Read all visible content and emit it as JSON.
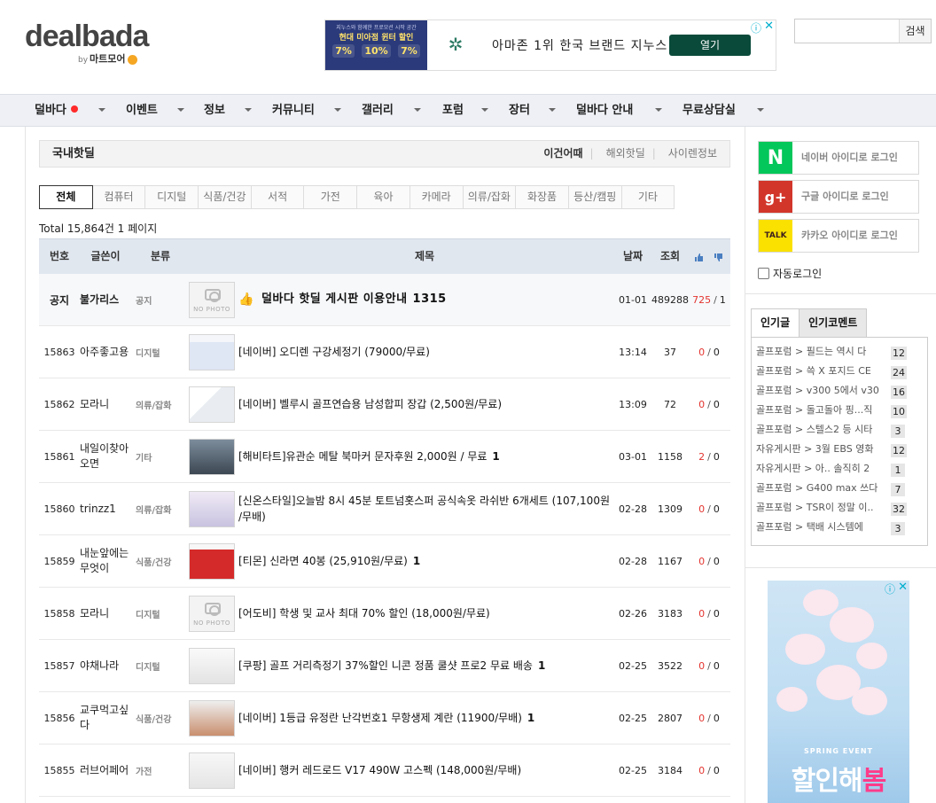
{
  "header": {
    "logo_main_1": "deal",
    "logo_main_2": "bada",
    "logo_by": "by",
    "logo_sub": "마트모어",
    "search_button": "검색",
    "search_placeholder": ""
  },
  "top_ad": {
    "line1": "지누스와 함께한 프로모션 시작 공간",
    "line2": "현대 미아점 윈터 할인",
    "pcts": [
      "7%",
      "10%",
      "7%"
    ],
    "text": "아마존 1위 한국 브랜드 지누스",
    "button": "열기"
  },
  "nav": {
    "items": [
      "덜바다",
      "이벤트",
      "정보",
      "커뮤니티",
      "갤러리",
      "포럼",
      "장터",
      "덜바다 안내",
      "무료상담실"
    ]
  },
  "board": {
    "title": "국내핫딜",
    "tabs": [
      "이건어때",
      "해외핫딜",
      "사이렌정보"
    ],
    "categories": [
      "전체",
      "컴퓨터",
      "디지털",
      "식품/건강",
      "서적",
      "가전",
      "육아",
      "카메라",
      "의류/잡화",
      "화장품",
      "등산/캠핑",
      "기타"
    ],
    "total": "Total 15,864건 1 페이지",
    "columns": {
      "num": "번호",
      "writer": "글쓴이",
      "cat": "분류",
      "title": "제목",
      "date": "날짜",
      "views": "조회"
    },
    "notice": {
      "num": "공지",
      "writer": "불가리스",
      "cat": "공지",
      "title": "덜바다 핫딜 게시판 이용안내",
      "comments": "1315",
      "date": "01-01",
      "views": "489288",
      "up": "725",
      "down": "1"
    },
    "rows": [
      {
        "num": "15863",
        "writer": "아주좋고용",
        "cat": "디지털",
        "title": "[네이버] 오디렌 구강세정기 (79000/무료)",
        "comments": "",
        "date": "13:14",
        "views": "37",
        "up": "0",
        "down": "0"
      },
      {
        "num": "15862",
        "writer": "모라니",
        "cat": "의류/잡화",
        "title": "[네이버] 벨루시 골프연습용 남성합피 장갑 (2,500원/무료)",
        "comments": "",
        "date": "13:09",
        "views": "72",
        "up": "0",
        "down": "0"
      },
      {
        "num": "15861",
        "writer": "내일이찾아오면",
        "cat": "기타",
        "title": "[해비타트]유관순 메탈 북마커 문자후원 2,000원 / 무료",
        "comments": "1",
        "date": "03-01",
        "views": "1158",
        "up": "2",
        "down": "0"
      },
      {
        "num": "15860",
        "writer": "trinzz1",
        "cat": "의류/잡화",
        "title": "[신온스타일]오늘밤 8시 45분 토트넘홋스퍼 공식속옷 라쉬반 6개세트 (107,100원 /무배)",
        "comments": "",
        "date": "02-28",
        "views": "1309",
        "up": "0",
        "down": "0"
      },
      {
        "num": "15859",
        "writer": "내눈앞에는무엇이",
        "cat": "식품/건강",
        "title": "[티몬] 신라면 40봉 (25,910원/무료)",
        "comments": "1",
        "date": "02-28",
        "views": "1167",
        "up": "0",
        "down": "0"
      },
      {
        "num": "15858",
        "writer": "모라니",
        "cat": "디지털",
        "title": "[어도비] 학생 및 교사 최대 70% 할인 (18,000원/무료)",
        "comments": "",
        "date": "02-26",
        "views": "3183",
        "up": "0",
        "down": "0"
      },
      {
        "num": "15857",
        "writer": "야채나라",
        "cat": "디지털",
        "title": "[쿠팡] 골프 거리측정기 37%할인 니콘 정품 쿨샷 프로2 무료 배송",
        "comments": "1",
        "date": "02-25",
        "views": "3522",
        "up": "0",
        "down": "0"
      },
      {
        "num": "15856",
        "writer": "교쿠먹고싶다",
        "cat": "식품/건강",
        "title": "[네이버] 1등급 유정란 난각번호1 무항생제 계란 (11900/무배)",
        "comments": "1",
        "date": "02-25",
        "views": "2807",
        "up": "0",
        "down": "0"
      },
      {
        "num": "15855",
        "writer": "러브어페어",
        "cat": "가전",
        "title": "[네이버] 행커 레드로드 V17 490W 고스펙 (148,000원/무배)",
        "comments": "",
        "date": "02-25",
        "views": "3184",
        "up": "0",
        "down": "0"
      }
    ],
    "no_photo": "NO PHOTO"
  },
  "sidebar": {
    "login": [
      {
        "label": "네이버 아이디로 로그인",
        "mark": "N",
        "color": "#03c75a"
      },
      {
        "label": "구글 아이디로 로그인",
        "mark": "g+",
        "color": "#d2362b"
      },
      {
        "label": "카카오 아이디로 로그인",
        "mark": "TALK",
        "color": "#fae100"
      }
    ],
    "auto_login": "자동로그인",
    "pop_tabs": [
      "인기글",
      "인기코멘트"
    ],
    "popular": [
      {
        "text": "골프포럼 > 필드는 역시 다",
        "count": "12"
      },
      {
        "text": "골프포럼 > 쓱 X 포지드 CE",
        "count": "24"
      },
      {
        "text": "골프포럼 > v300 5에서 v30",
        "count": "16"
      },
      {
        "text": "골프포럼 > 돌고돌아 핑...직",
        "count": "10"
      },
      {
        "text": "골프포럼 > 스텔스2 등 시타",
        "count": "3"
      },
      {
        "text": "자유게시판 > 3월 EBS 영화",
        "count": "12"
      },
      {
        "text": "자유게시판 > 아.. 솔직히 2",
        "count": "1"
      },
      {
        "text": "골프포럼 > G400 max 쓰다",
        "count": "7"
      },
      {
        "text": "골프포럼 > TSR이 정말 이..",
        "count": "32"
      },
      {
        "text": "골프포럼 > 택배 시스템에",
        "count": "3"
      }
    ],
    "ad": {
      "spring": "SPRING EVENT",
      "sale_1": "할인해",
      "sale_2": "봄"
    }
  }
}
